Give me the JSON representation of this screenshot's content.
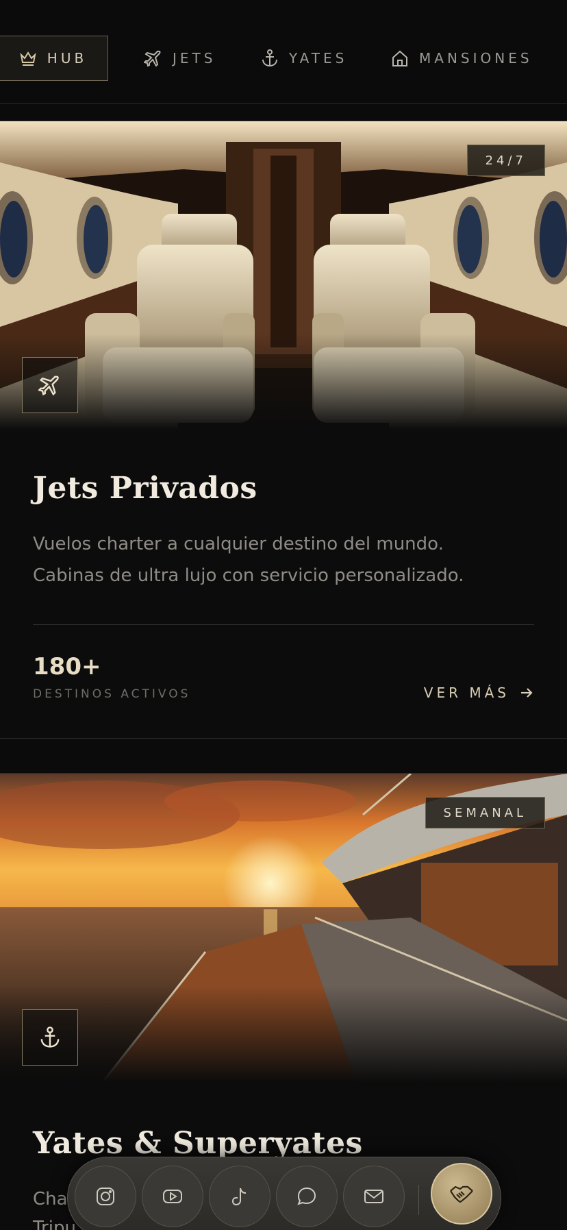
{
  "nav": {
    "items": [
      {
        "label": "HUB",
        "icon": "crown-icon",
        "active": true
      },
      {
        "label": "JETS",
        "icon": "plane-icon",
        "active": false
      },
      {
        "label": "YATES",
        "icon": "anchor-icon",
        "active": false
      },
      {
        "label": "MANSIONES",
        "icon": "house-icon",
        "active": false
      }
    ]
  },
  "cards": {
    "jets": {
      "badge": "24/7",
      "icon": "plane-icon",
      "title": "Jets Privados",
      "description_line1": "Vuelos charter a cualquier destino del mundo.",
      "description_line2": "Cabinas de ultra lujo con servicio personalizado.",
      "stat_value": "180+",
      "stat_label": "DESTINOS ACTIVOS",
      "link_label": "VER MÁS"
    },
    "yachts": {
      "badge": "SEMANAL",
      "icon": "anchor-icon",
      "title": "Yates & Superyates",
      "description_partial_line1": "Cha",
      "description_partial_line2": "Tripu"
    }
  },
  "dock": {
    "items": [
      {
        "icon": "instagram-icon"
      },
      {
        "icon": "youtube-icon"
      },
      {
        "icon": "tiktok-icon"
      },
      {
        "icon": "chat-icon"
      },
      {
        "icon": "mail-icon"
      }
    ],
    "primary": {
      "icon": "handshake-icon"
    }
  },
  "colors": {
    "background": "#0b0b0b",
    "accent_gold": "#cdb98f",
    "text_primary": "#f1ebdf",
    "text_muted": "#8f8c86"
  }
}
